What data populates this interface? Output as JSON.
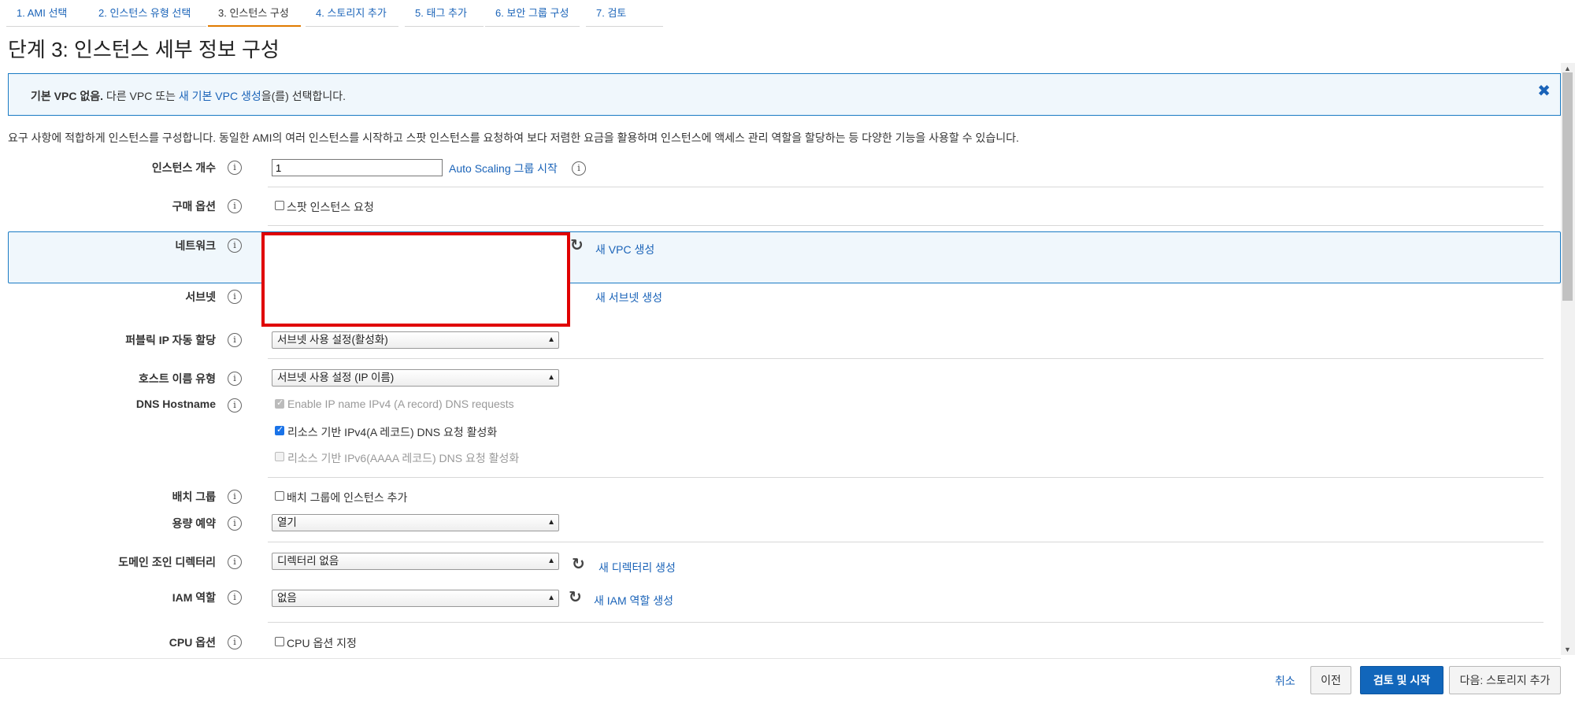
{
  "wizard_tabs": [
    "1. AMI 선택",
    "2. 인스턴스 유형 선택",
    "3. 인스턴스 구성",
    "4. 스토리지 추가",
    "5. 태그 추가",
    "6. 보안 그룹 구성",
    "7. 검토"
  ],
  "page_title": "단계 3: 인스턴스 세부 정보 구성",
  "notice": {
    "bold": "기본 VPC 없음.",
    "text1": " 다른 VPC 또는 ",
    "link": "새 기본 VPC 생성",
    "text2": "을(를) 선택합니다.",
    "close": "✖"
  },
  "description": "요구 사항에 적합하게 인스턴스를 구성합니다. 동일한 AMI의 여러 인스턴스를 시작하고 스팟 인스턴스를 요청하여 보다 저렴한 요금을 활용하며 인스턴스에 액세스 관리 역할을 할당하는 등 다양한 기능을 사용할 수 있습니다.",
  "info_icon": "i",
  "fields": {
    "instance_count": {
      "label": "인스턴스 개수",
      "value": "1",
      "link": "Auto Scaling 그룹 시작"
    },
    "purchase": {
      "label": "구매 옵션",
      "checkbox": "스팟 인스턴스 요청",
      "checked": false
    },
    "network": {
      "label": "네트워크",
      "link": "새 VPC 생성"
    },
    "subnet": {
      "label": "서브넷",
      "link": "새 서브넷 생성"
    },
    "public_ip": {
      "label": "퍼블릭 IP 자동 할당",
      "value": "서브넷 사용 설정(활성화)"
    },
    "hostname_type": {
      "label": "호스트 이름 유형",
      "value": "서브넷 사용 설정 (IP 이름)"
    },
    "dns_hostname": {
      "label": "DNS Hostname",
      "options": [
        {
          "label": "Enable IP name IPv4 (A record) DNS requests",
          "checked": true,
          "disabled": true
        },
        {
          "label": "리소스 기반 IPv4(A 레코드) DNS 요청 활성화",
          "checked": true,
          "disabled": false
        },
        {
          "label": "리소스 기반 IPv6(AAAA 레코드) DNS 요청 활성화",
          "checked": false,
          "disabled": true
        }
      ]
    },
    "placement": {
      "label": "배치 그룹",
      "checkbox": "배치 그룹에 인스턴스 추가",
      "checked": false
    },
    "capacity": {
      "label": "용량 예약",
      "value": "열기"
    },
    "domain": {
      "label": "도메인 조인 디렉터리",
      "value": "디렉터리 없음",
      "link": "새 디렉터리 생성"
    },
    "iam": {
      "label": "IAM 역할",
      "value": "없음",
      "link": "새 IAM 역할 생성"
    },
    "cpu": {
      "label": "CPU 옵션",
      "checkbox": "CPU 옵션 지정",
      "checked": false
    }
  },
  "footer": {
    "cancel": "취소",
    "previous": "이전",
    "review_launch": "검토 및 시작",
    "next": "다음: 스토리지 추가"
  },
  "colors": {
    "link": "#1a63b8",
    "primary": "#1166bb",
    "highlight_border": "#e00000",
    "active_tab": "#e07b00"
  }
}
